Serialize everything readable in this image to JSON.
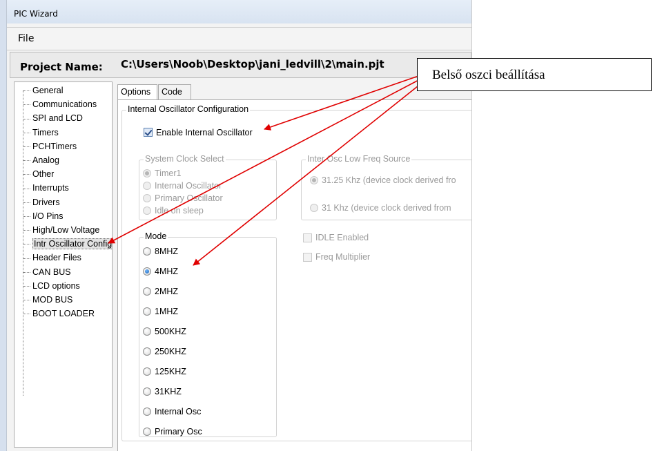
{
  "window": {
    "title": "PIC Wizard"
  },
  "menu": {
    "file": "File"
  },
  "project": {
    "label": "Project Name:",
    "path": "C:\\Users\\Noob\\Desktop\\jani_ledvill\\2\\main.pjt"
  },
  "tree": {
    "items": [
      "General",
      "Communications",
      "SPI and LCD",
      "Timers",
      "PCHTimers",
      "Analog",
      "Other",
      "Interrupts",
      "Drivers",
      "I/O Pins",
      "High/Low Voltage",
      "Intr Oscillator Config",
      "Header Files",
      "CAN BUS",
      "LCD options",
      "MOD BUS",
      "BOOT LOADER"
    ],
    "selected_index": 11
  },
  "tabs": [
    "Options",
    "Code"
  ],
  "options": {
    "group_title": "Internal Oscillator Configuration",
    "enable_internal_osc": {
      "label": "Enable Internal Oscillator",
      "checked": true
    },
    "system_clock": {
      "title": "System Clock Select",
      "options": [
        "Timer1",
        "Internal Oscillator",
        "Primary Oscillator",
        "Idle on sleep"
      ],
      "selected_index": 0,
      "enabled": false
    },
    "low_freq": {
      "title": "Inter Osc Low Freq Source",
      "options": [
        "31.25 Khz  (device clock derived fro",
        "31 Khz  (device clock derived from"
      ],
      "selected_index": 0,
      "enabled": false
    },
    "idle_enabled": {
      "label": "IDLE Enabled",
      "checked": false,
      "enabled": false
    },
    "freq_multiplier": {
      "label": "Freq Multiplier",
      "checked": false,
      "enabled": false
    },
    "mode": {
      "title": "Mode",
      "options": [
        "8MHZ",
        "4MHZ",
        "2MHZ",
        "1MHZ",
        "500KHZ",
        "250KHZ",
        "125KHZ",
        "31KHZ",
        "Internal Osc",
        "Primary Osc"
      ],
      "selected_index": 1
    }
  },
  "callout": {
    "text": "Belső oszci beállítása"
  },
  "colors": {
    "arrow": "#e00000",
    "title_bar": "#dbe5f2",
    "selection": "#e3e3e3"
  }
}
